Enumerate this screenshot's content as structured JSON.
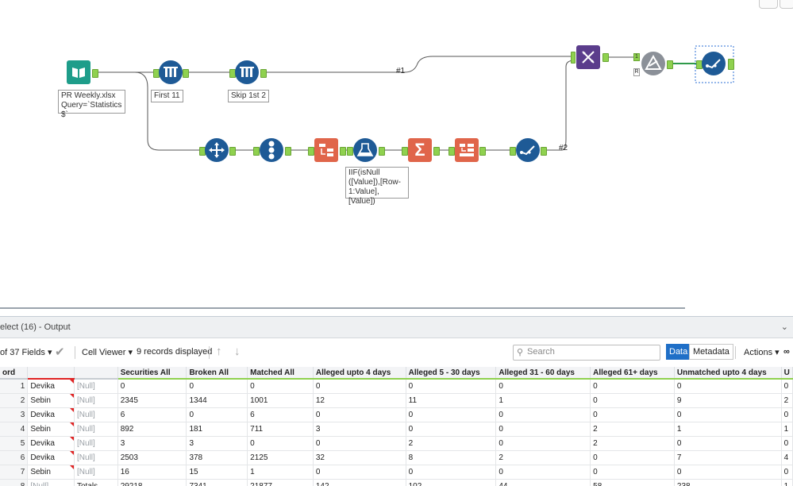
{
  "canvas": {
    "tools": {
      "input": {
        "label": "PR Weekly.xlsx\nQuery=`Statistics\n$`"
      },
      "first_sample": {
        "label": "First 11"
      },
      "skip_sample": {
        "label": "Skip 1st 2"
      },
      "formula": {
        "label": "IIF(isNull\n([Value]),[Row-\n1:Value],[Value])"
      }
    },
    "wire_labels": {
      "w1": "#1",
      "w2": "#2"
    },
    "join_anchors": {
      "top": "1",
      "bottom": "R"
    }
  },
  "results": {
    "title": "elect (16) - Output",
    "toolbar": {
      "fields_label": "of 37 Fields",
      "cell_viewer_label": "Cell Viewer",
      "records_text": "9 records displayed",
      "search_placeholder": "Search",
      "data_tab": "Data",
      "metadata_tab": "Metadata",
      "actions_label": "Actions"
    },
    "columns": [
      "ord",
      "",
      "",
      "Securities All",
      "Broken All",
      "Matched All",
      "Alleged upto 4 days",
      "Alleged 5 - 30 days",
      "Alleged 31 - 60 days",
      "Alleged 61+ days",
      "Unmatched upto 4 days",
      "U"
    ],
    "rows": [
      [
        "1",
        "Devika",
        "[Null]",
        "0",
        "0",
        "0",
        "0",
        "0",
        "0",
        "0",
        "0",
        "0"
      ],
      [
        "2",
        "Sebin",
        "[Null]",
        "2345",
        "1344",
        "1001",
        "12",
        "11",
        "1",
        "0",
        "9",
        "2"
      ],
      [
        "3",
        "Devika",
        "[Null]",
        "6",
        "0",
        "6",
        "0",
        "0",
        "0",
        "0",
        "0",
        "0"
      ],
      [
        "4",
        "Sebin",
        "[Null]",
        "892",
        "181",
        "711",
        "3",
        "0",
        "0",
        "2",
        "1",
        "1"
      ],
      [
        "5",
        "Devika",
        "[Null]",
        "3",
        "3",
        "0",
        "0",
        "2",
        "0",
        "2",
        "0",
        "0"
      ],
      [
        "6",
        "Devika",
        "[Null]",
        "2503",
        "378",
        "2125",
        "32",
        "8",
        "2",
        "0",
        "7",
        "4"
      ],
      [
        "7",
        "Sebin",
        "[Null]",
        "16",
        "15",
        "1",
        "0",
        "0",
        "0",
        "0",
        "0",
        "0"
      ],
      [
        "8",
        "[Null]",
        "Totals",
        "29218",
        "7341",
        "21877",
        "142",
        "102",
        "44",
        "58",
        "238",
        "1"
      ]
    ]
  }
}
